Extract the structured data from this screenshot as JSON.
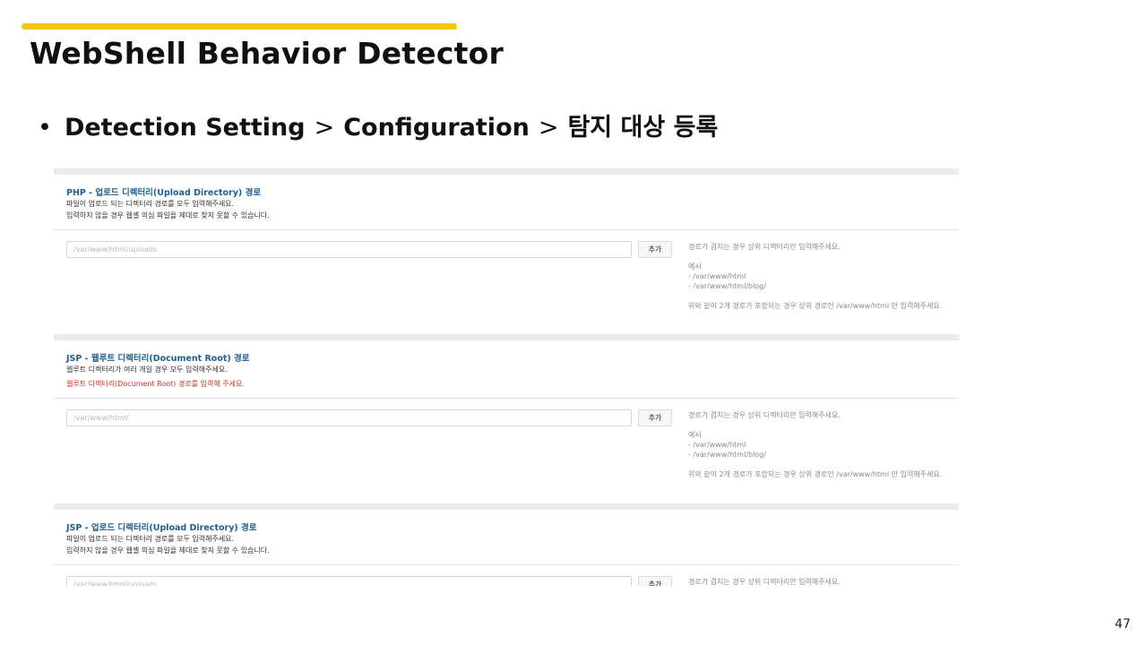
{
  "slide": {
    "title": "WebShell Behavior Detector",
    "accent_color": "#f5c518",
    "breadcrumb": {
      "bullet": "•",
      "items": [
        "Detection Setting",
        "Configuration",
        "탐지 대상 등록"
      ],
      "separator": ">"
    },
    "page_number": "47"
  },
  "sections": [
    {
      "title": "PHP - 업로드 디렉터리(Upload Directory) 경로",
      "desc_line1": "파일이 업로드 되는 디렉터리 경로를 모두 입력해주세요.",
      "desc_line2": "입력하지 않을 경우 웹셸 의심 파일을 제대로 찾지 못할 수 있습니다.",
      "input_placeholder": "/var/www/html/uploads",
      "add_label": "추가",
      "help": {
        "line1": "경로가 겹치는 경우 상위 디렉터리만 입력해주세요.",
        "example_label": "예시",
        "example1": "- /var/www/html",
        "example2": "- /var/www/html/blog/",
        "note": "위와 같이 2개 경로가 포함되는 경우 상위 경로인 /var/www/html 만 입력해주세요."
      }
    },
    {
      "title": "JSP - 웹루트 디렉터리(Document Root) 경로",
      "desc_line1": "웹루트 디렉터리가 여러 개일 경우 모두 입력해주세요.",
      "desc_line2_warning": "웹루트 디렉터리(Document Root) 경로를 입력해 주세요.",
      "input_placeholder": "/var/www/html/",
      "add_label": "추가",
      "help": {
        "line1": "경로가 겹치는 경우 상위 디렉터리만 입력해주세요.",
        "example_label": "예시",
        "example1": "- /var/www/html",
        "example2": "- /var/www/html/blog/",
        "note": "위와 같이 2개 경로가 포함되는 경우 상위 경로인 /var/www/html 만 입력해주세요."
      }
    },
    {
      "title": "JSP - 업로드 디렉터리(Upload Directory) 경로",
      "desc_line1": "파일이 업로드 되는 디렉터리 경로를 모두 입력해주세요.",
      "desc_line2": "입력하지 않을 경우 웹셸 의심 파일을 제대로 찾지 못할 수 있습니다.",
      "input_placeholder": "/var/www/html/uploads",
      "add_label": "추가",
      "help": {
        "line1": "경로가 겹치는 경우 상위 디렉터리만 입력해주세요."
      }
    }
  ],
  "colors": {
    "section_title": "#1f5f8f",
    "warning_text": "#c0392b",
    "help_text": "#8a8a8a",
    "section_band": "#ebebeb"
  }
}
